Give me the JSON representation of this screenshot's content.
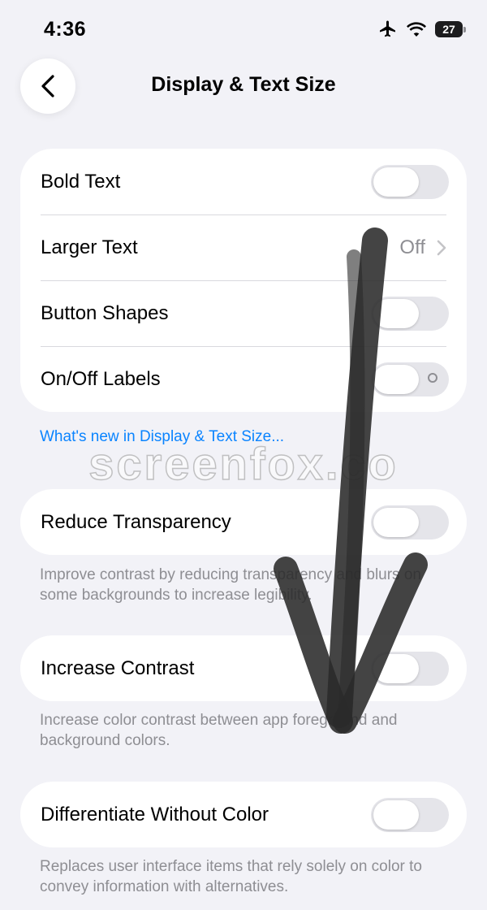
{
  "status": {
    "time": "4:36",
    "battery": "27"
  },
  "nav": {
    "title": "Display & Text Size",
    "back_icon": "chevron-left-icon"
  },
  "group1": {
    "rows": [
      {
        "label": "Bold Text",
        "control": "toggle",
        "on": false
      },
      {
        "label": "Larger Text",
        "control": "disclosure",
        "value": "Off"
      },
      {
        "label": "Button Shapes",
        "control": "toggle",
        "on": false
      },
      {
        "label": "On/Off Labels",
        "control": "toggle",
        "on": false
      }
    ]
  },
  "link": {
    "text": "What's new in Display & Text Size..."
  },
  "watermark": "screenfox.co",
  "reduce_transparency": {
    "label": "Reduce Transparency",
    "on": false,
    "footnote": "Improve contrast by reducing transparency and blurs on some backgrounds to increase legibility."
  },
  "increase_contrast": {
    "label": "Increase Contrast",
    "on": false,
    "footnote": "Increase color contrast between app foreground and background colors."
  },
  "differentiate": {
    "label": "Differentiate Without Color",
    "on": false,
    "footnote": "Replaces user interface items that rely solely on color to convey information with alternatives."
  },
  "colors": {
    "accent": "#0a84ff",
    "background": "#f2f2f7",
    "toggle_off": "#e5e5ea",
    "secondary_text": "#8e8e93"
  }
}
